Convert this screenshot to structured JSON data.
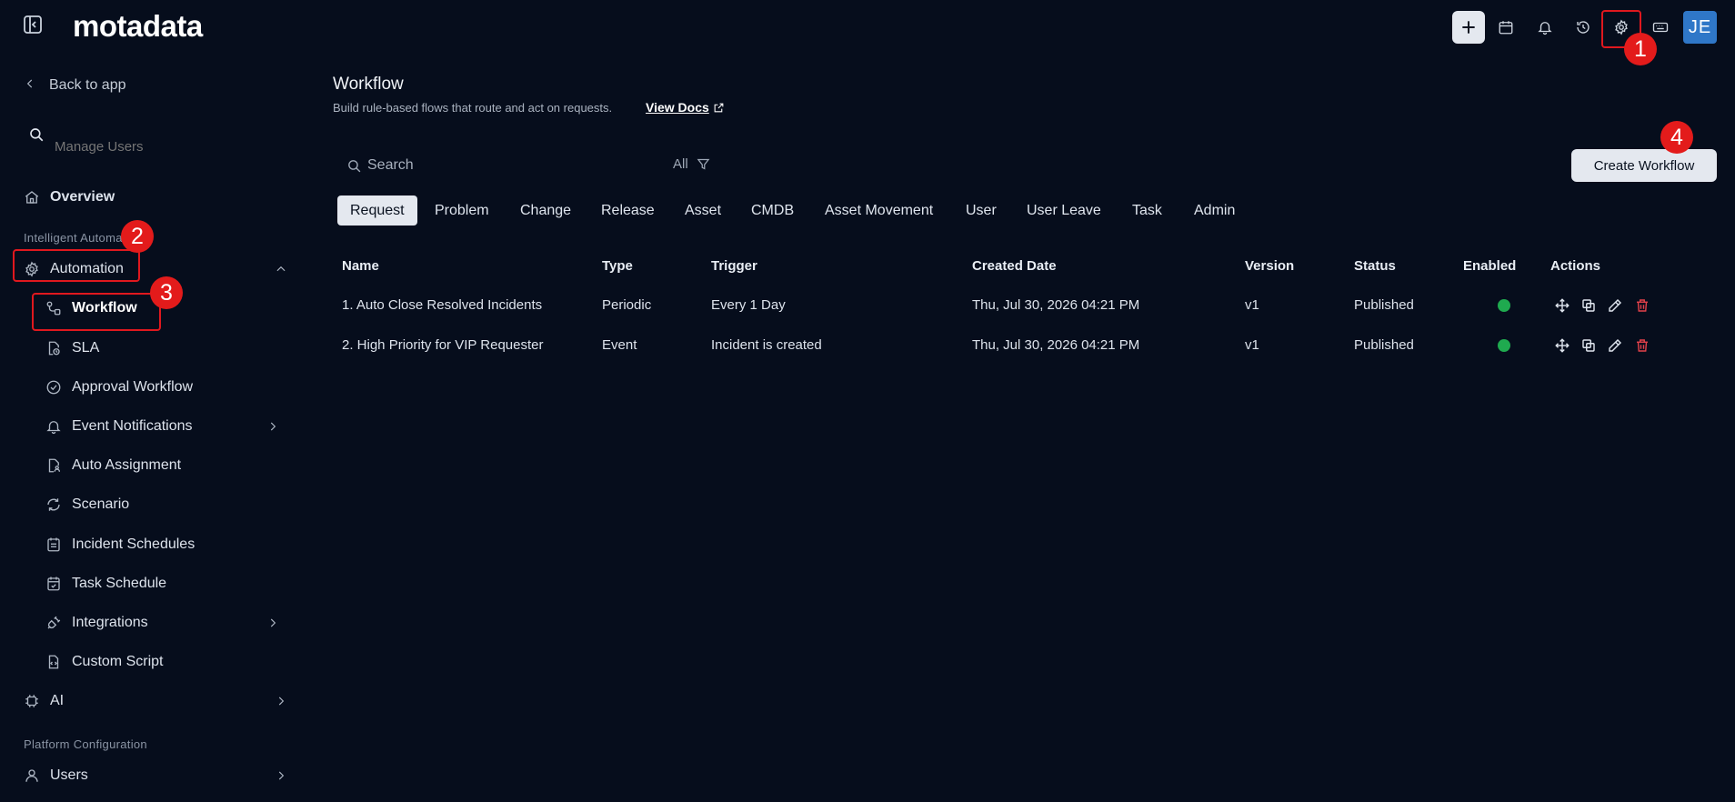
{
  "topbar": {
    "logo": "motadata",
    "avatar_initials": "JE"
  },
  "sidebar": {
    "back_label": "Back to app",
    "search_placeholder": "Manage Users",
    "overview_label": "Overview",
    "section_automation": "Intelligent Automation",
    "automation_label": "Automation",
    "items": [
      {
        "label": "Workflow",
        "icon": "workflow-icon"
      },
      {
        "label": "SLA",
        "icon": "sla-icon"
      },
      {
        "label": "Approval Workflow",
        "icon": "check-circle-icon"
      },
      {
        "label": "Event Notifications",
        "icon": "bell-icon"
      },
      {
        "label": "Auto Assignment",
        "icon": "file-user-icon"
      },
      {
        "label": "Scenario",
        "icon": "refresh-icon"
      },
      {
        "label": "Incident Schedules",
        "icon": "calendar-list-icon"
      },
      {
        "label": "Task Schedule",
        "icon": "calendar-check-icon"
      },
      {
        "label": "Integrations",
        "icon": "plug-icon"
      },
      {
        "label": "Custom Script",
        "icon": "script-icon"
      }
    ],
    "ai_label": "AI",
    "section_platform": "Platform Configuration",
    "users_label": "Users"
  },
  "main": {
    "title": "Workflow",
    "subtitle": "Build rule-based flows that route and act on requests.",
    "view_docs": "View Docs",
    "search_placeholder": "Search",
    "filter_label": "All",
    "create_label": "Create Workflow",
    "tabs": [
      "Request",
      "Problem",
      "Change",
      "Release",
      "Asset",
      "CMDB",
      "Asset Movement",
      "User",
      "User Leave",
      "Task",
      "Admin"
    ],
    "active_tab": "Request",
    "columns": [
      "Name",
      "Type",
      "Trigger",
      "Created Date",
      "Version",
      "Status",
      "Enabled",
      "Actions"
    ],
    "rows": [
      {
        "name": "1. Auto Close Resolved Incidents",
        "type": "Periodic",
        "trigger": "Every 1 Day",
        "created": "Thu, Jul 30, 2026 04:21 PM",
        "version": "v1",
        "status": "Published",
        "enabled": true
      },
      {
        "name": "2. High Priority for VIP Requester",
        "type": "Event",
        "trigger": "Incident is created",
        "created": "Thu, Jul 30, 2026 04:21 PM",
        "version": "v1",
        "status": "Published",
        "enabled": true
      }
    ]
  },
  "annotations": {
    "badge_1": "1",
    "badge_2": "2",
    "badge_3": "3",
    "badge_4": "4",
    "color": "#e31b1b"
  },
  "colors": {
    "background": "#060d1c",
    "enabled_green": "#1faa4f",
    "delete_red": "#e2414a",
    "avatar_blue": "#2f77c8"
  }
}
